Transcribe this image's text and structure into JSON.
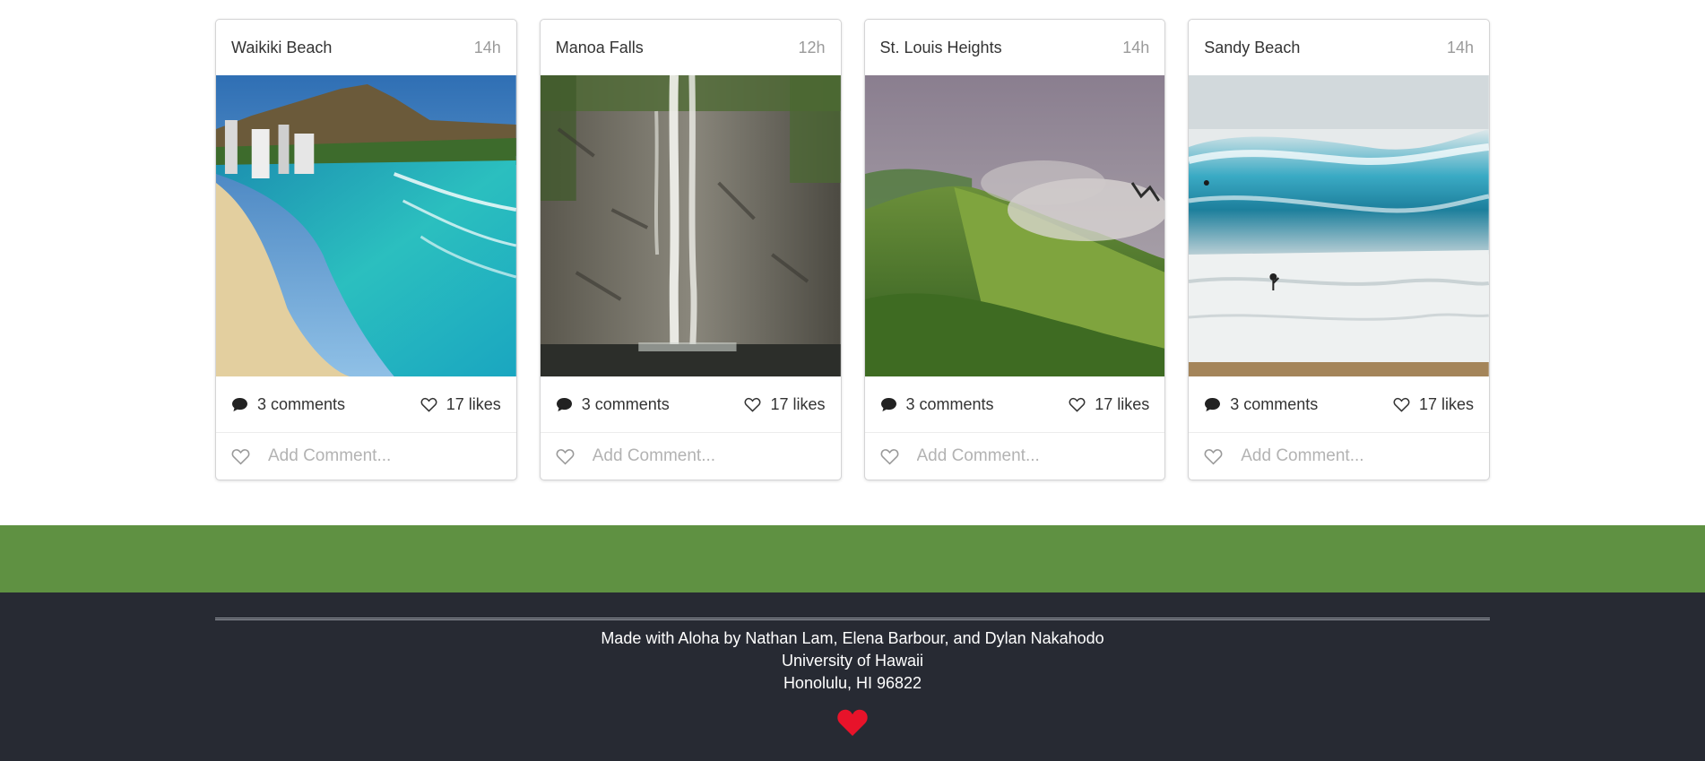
{
  "cards": [
    {
      "title": "Waikiki Beach",
      "time": "14h",
      "comments": "3 comments",
      "likes": "17 likes",
      "comment_placeholder": "Add Comment...",
      "image": "waikiki-beach-photo"
    },
    {
      "title": "Manoa Falls",
      "time": "12h",
      "comments": "3 comments",
      "likes": "17 likes",
      "comment_placeholder": "Add Comment...",
      "image": "manoa-falls-photo"
    },
    {
      "title": "St. Louis Heights",
      "time": "14h",
      "comments": "3 comments",
      "likes": "17 likes",
      "comment_placeholder": "Add Comment...",
      "image": "st-louis-heights-photo"
    },
    {
      "title": "Sandy Beach",
      "time": "14h",
      "comments": "3 comments",
      "likes": "17 likes",
      "comment_placeholder": "Add Comment...",
      "image": "sandy-beach-photo"
    }
  ],
  "footer": {
    "line1": "Made with Aloha by Nathan Lam, Elena Barbour, and Dylan Nakahodo",
    "line2": "University of Hawaii",
    "line3": "Honolulu, HI 96822",
    "icon": "heart-icon"
  },
  "colors": {
    "green_band": "#5f9142",
    "footer_bg": "#272a33",
    "heart": "#e8132a"
  }
}
